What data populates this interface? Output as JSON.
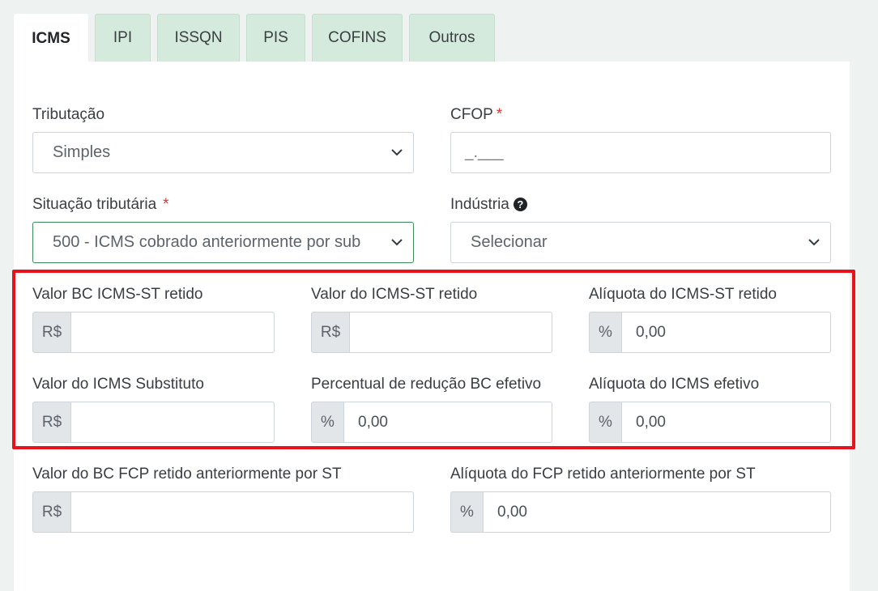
{
  "tabs": [
    {
      "label": "ICMS",
      "active": true
    },
    {
      "label": "IPI"
    },
    {
      "label": "ISSQN"
    },
    {
      "label": "PIS"
    },
    {
      "label": "COFINS"
    },
    {
      "label": "Outros"
    }
  ],
  "form": {
    "tributacao": {
      "label": "Tributação",
      "value": "Simples"
    },
    "cfop": {
      "label": "CFOP",
      "required_mark": "*",
      "placeholder": "_.___"
    },
    "situacao": {
      "label": "Situação tributária",
      "required_mark": "*",
      "value": "500 - ICMS cobrado anteriormente por sub"
    },
    "industria": {
      "label": "Indústria",
      "help_icon": "?",
      "value": "Selecionar"
    },
    "valor_bc_icms_st": {
      "label": "Valor BC ICMS-ST retido",
      "prefix": "R$",
      "value": ""
    },
    "valor_icms_st": {
      "label": "Valor do ICMS-ST retido",
      "prefix": "R$",
      "value": ""
    },
    "aliquota_icms_st": {
      "label": "Alíquota do ICMS-ST retido",
      "prefix": "%",
      "value": "0,00"
    },
    "valor_icms_substituto": {
      "label": "Valor do ICMS Substituto",
      "prefix": "R$",
      "value": ""
    },
    "percentual_reducao": {
      "label": "Percentual de redução BC efetivo",
      "prefix": "%",
      "value": "0,00"
    },
    "aliquota_icms_efetivo": {
      "label": "Alíquota do ICMS efetivo",
      "prefix": "%",
      "value": "0,00"
    },
    "valor_bc_fcp": {
      "label": "Valor do BC FCP retido anteriormente por ST",
      "prefix": "R$",
      "value": ""
    },
    "aliquota_fcp": {
      "label": "Alíquota do FCP retido anteriormente por ST",
      "prefix": "%",
      "value": "0,00"
    }
  },
  "colors": {
    "highlight": "#e8121b",
    "tab_inactive": "#d4eadd",
    "valid_border": "#3a8b56",
    "required": "#e03131"
  }
}
